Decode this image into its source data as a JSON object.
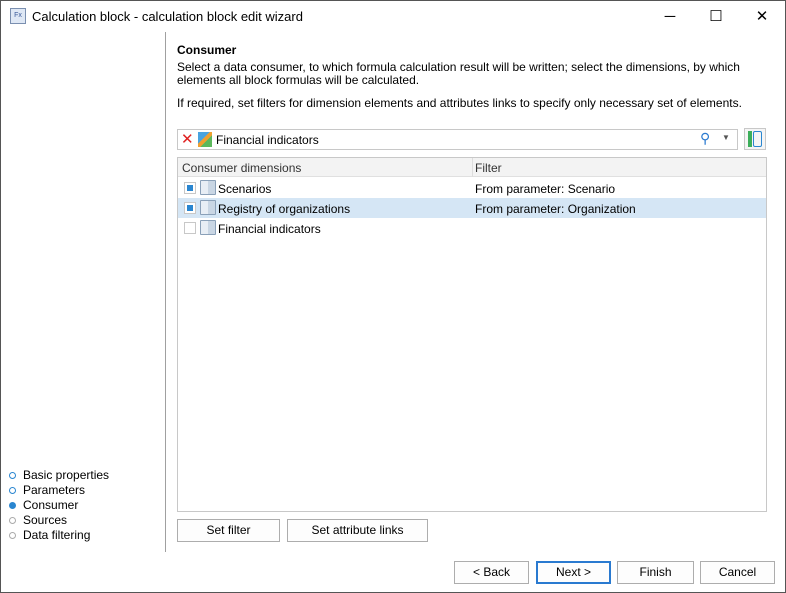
{
  "window": {
    "title": "Calculation block - calculation block edit wizard",
    "minimize": "─",
    "maximize": "☐",
    "close": "✕"
  },
  "nav": {
    "items": [
      {
        "label": "Basic properties",
        "state": "done"
      },
      {
        "label": "Parameters",
        "state": "done"
      },
      {
        "label": "Consumer",
        "state": "current"
      },
      {
        "label": "Sources",
        "state": "pending"
      },
      {
        "label": "Data filtering",
        "state": "pending"
      }
    ]
  },
  "page": {
    "heading": "Consumer",
    "description": "Select a data consumer, to which formula calculation result will be written; select the dimensions, by which elements all block formulas will be calculated.",
    "hint": "If required, set filters for dimension elements and attributes links to specify only necessary set of elements."
  },
  "consumer": {
    "value": "Financial indicators",
    "clear": "✕",
    "search": "⚲",
    "dropdown": "▼"
  },
  "table": {
    "headers": [
      "Consumer dimensions",
      "Filter"
    ],
    "rows": [
      {
        "name": "Scenarios",
        "filter": "From parameter: Scenario",
        "checked": true,
        "selected": false
      },
      {
        "name": "Registry of organizations",
        "filter": "From parameter: Organization",
        "checked": true,
        "selected": true
      },
      {
        "name": "Financial indicators",
        "filter": "",
        "checked": false,
        "selected": false
      }
    ]
  },
  "buttons": {
    "set_filter": "Set filter",
    "set_links": "Set attribute links",
    "back": "< Back",
    "next": "Next >",
    "finish": "Finish",
    "cancel": "Cancel"
  }
}
